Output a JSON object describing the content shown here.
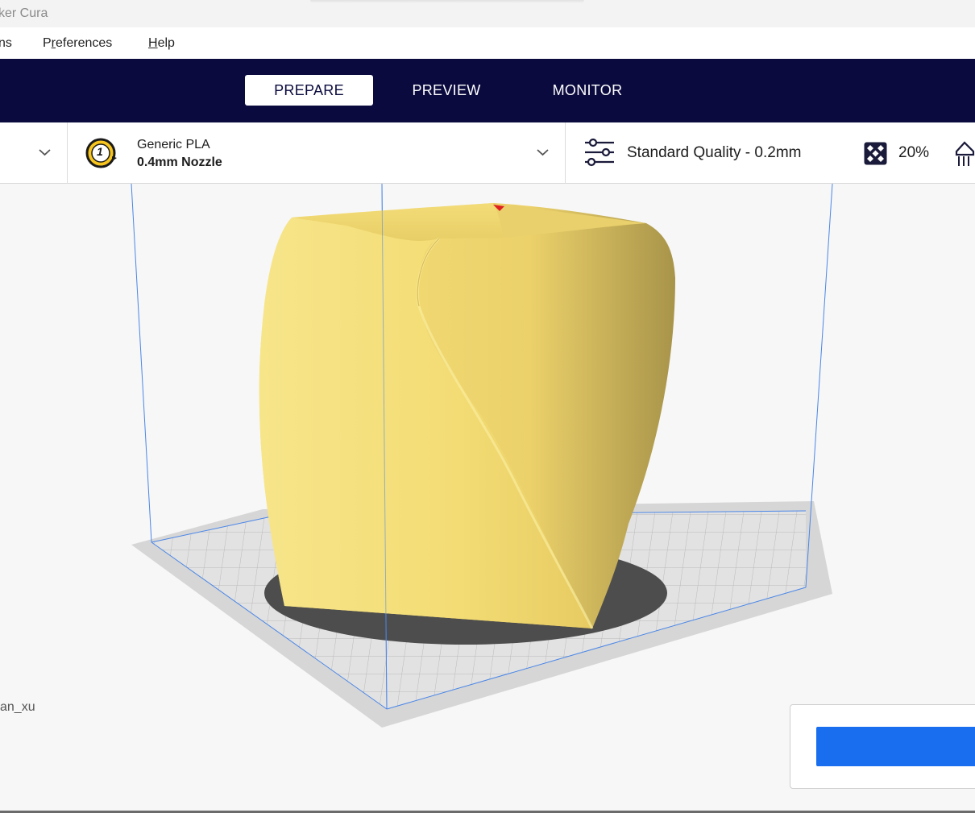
{
  "window": {
    "title": "ker Cura"
  },
  "menu": {
    "items": [
      {
        "label": "ns"
      },
      {
        "label": "Preferences",
        "mnemonic": "r"
      },
      {
        "label": "Help",
        "mnemonic": "H"
      }
    ]
  },
  "stages": {
    "tabs": [
      {
        "label": "PREPARE",
        "active": true
      },
      {
        "label": "PREVIEW",
        "active": false
      },
      {
        "label": "MONITOR",
        "active": false
      }
    ]
  },
  "printer_setup": {
    "extruder_number": "1",
    "material": "Generic PLA",
    "nozzle": "0.4mm Nozzle"
  },
  "print_settings": {
    "quality": "Standard Quality - 0.2mm",
    "infill": "20%"
  },
  "viewport": {
    "object_name": "an_xu",
    "model_color": "#f5e27a",
    "buildplate_color": "#d3d3d3",
    "volume_line_color": "#4a86e8"
  },
  "colors": {
    "header_bg": "#0a0a3e",
    "accent_button": "#196ef0",
    "extruder_badge": "#f7c51e"
  }
}
